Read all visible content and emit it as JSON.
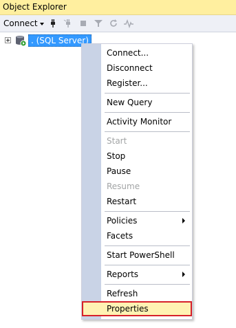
{
  "panel": {
    "title": "Object Explorer"
  },
  "toolbar": {
    "connect_label": "Connect",
    "icons": [
      "plug-icon",
      "disconnect-plug-icon",
      "stop-icon",
      "filter-icon",
      "refresh-icon",
      "activity-icon"
    ]
  },
  "tree": {
    "server_label": ". (SQL Server)"
  },
  "context_menu": {
    "items": [
      {
        "label": "Connect...",
        "enabled": true,
        "submenu": false
      },
      {
        "label": "Disconnect",
        "enabled": true,
        "submenu": false
      },
      {
        "label": "Register...",
        "enabled": true,
        "submenu": false
      },
      {
        "label": "New Query",
        "enabled": true,
        "submenu": false
      },
      {
        "label": "Activity Monitor",
        "enabled": true,
        "submenu": false
      },
      {
        "label": "Start",
        "enabled": false,
        "submenu": false
      },
      {
        "label": "Stop",
        "enabled": true,
        "submenu": false
      },
      {
        "label": "Pause",
        "enabled": true,
        "submenu": false
      },
      {
        "label": "Resume",
        "enabled": false,
        "submenu": false
      },
      {
        "label": "Restart",
        "enabled": true,
        "submenu": false
      },
      {
        "label": "Policies",
        "enabled": true,
        "submenu": true
      },
      {
        "label": "Facets",
        "enabled": true,
        "submenu": false
      },
      {
        "label": "Start PowerShell",
        "enabled": true,
        "submenu": false
      },
      {
        "label": "Reports",
        "enabled": true,
        "submenu": true
      },
      {
        "label": "Refresh",
        "enabled": true,
        "submenu": false
      },
      {
        "label": "Properties",
        "enabled": true,
        "submenu": false,
        "highlighted": true
      }
    ]
  },
  "colors": {
    "title_bar": "#ffef9f",
    "selection": "#3399ff",
    "highlight_box": "#d6202a",
    "highlight_fill": "#fff2b3"
  }
}
